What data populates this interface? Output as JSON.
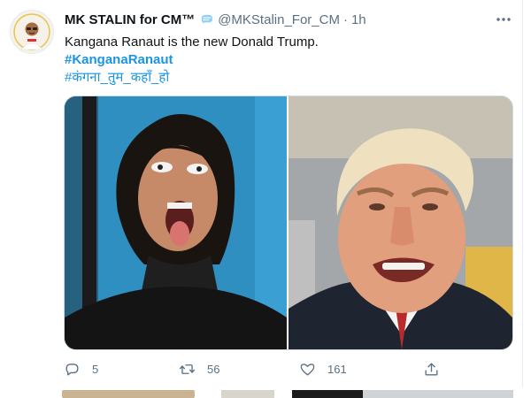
{
  "tweet": {
    "display_name": "MK STALIN for CM™",
    "handle": "@MKStalin_For_CM",
    "separator": "·",
    "time": "1h",
    "text": "Kangana Ranaut is the new Donald Trump.",
    "hashtag_1": "#KanganaRanaut",
    "hashtag_2": "#कंगना_तुम_कहाँ_हो",
    "media": [
      {
        "subject": "woman-making-face-photo"
      },
      {
        "subject": "man-grimacing-photo"
      }
    ],
    "actions": {
      "reply_count": "5",
      "retweet_count": "56",
      "like_count": "161"
    }
  },
  "colors": {
    "link": "#1b95e0",
    "secondary_text": "#5b7083",
    "verified_badge": "#1da1f2",
    "border": "#e6ecf0"
  },
  "icons": [
    "verified-icon",
    "more-icon",
    "reply-icon",
    "retweet-icon",
    "like-icon",
    "share-icon"
  ]
}
